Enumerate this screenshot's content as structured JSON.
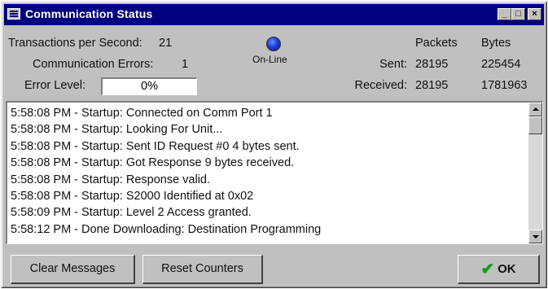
{
  "window": {
    "title": "Communication Status"
  },
  "stats": {
    "tps_label": "Transactions per Second:",
    "tps_value": "21",
    "errors_label": "Communication Errors:",
    "errors_value": "1",
    "error_level_label": "Error Level:",
    "error_level_value": "0%"
  },
  "status": {
    "online_label": "On-Line",
    "indicator_color": "#1f3fd6"
  },
  "counters": {
    "col_packets": "Packets",
    "col_bytes": "Bytes",
    "sent_label": "Sent:",
    "sent_packets": "28195",
    "sent_bytes": "225454",
    "received_label": "Received:",
    "received_packets": "28195",
    "received_bytes": "1781963"
  },
  "log": {
    "lines": [
      "5:58:08 PM - Startup: Connected on Comm Port 1",
      "5:58:08 PM - Startup: Looking For Unit...",
      "5:58:08 PM - Startup: Sent ID Request #0 4 bytes sent.",
      "5:58:08 PM - Startup: Got Response 9 bytes received.",
      "5:58:08 PM - Startup: Response valid.",
      "5:58:08 PM - Startup: S2000 Identified at 0x02",
      "5:58:09 PM - Startup: Level 2 Access granted.",
      "5:58:12 PM - Done Downloading: Destination Programming"
    ]
  },
  "buttons": {
    "clear": "Clear Messages",
    "reset": "Reset Counters",
    "ok": "OK"
  }
}
